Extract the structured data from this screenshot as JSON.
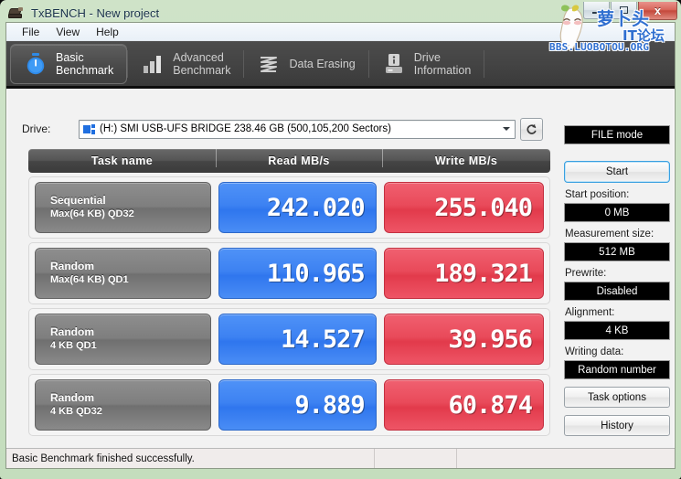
{
  "window": {
    "title": "TxBENCH - New project",
    "icon": "drive-stack-icon",
    "minimize_label": "–",
    "maximize_label": "□",
    "close_label": "x"
  },
  "menu": {
    "items": [
      {
        "label": "File"
      },
      {
        "label": "View"
      },
      {
        "label": "Help"
      }
    ]
  },
  "tabs": [
    {
      "label": "Basic\nBenchmark",
      "icon": "stopwatch-icon",
      "active": true
    },
    {
      "label": "Advanced\nBenchmark",
      "icon": "bar-chart-icon",
      "active": false
    },
    {
      "label": "Data Erasing",
      "icon": "shredder-icon",
      "active": false
    },
    {
      "label": "Drive\nInformation",
      "icon": "drive-info-icon",
      "active": false
    }
  ],
  "drive": {
    "label": "Drive:",
    "selected": "(H:) SMI USB-UFS BRIDGE  238.46 GB (500,105,200 Sectors)",
    "icon": "drive-icon",
    "refresh_icon": "refresh-icon"
  },
  "table": {
    "headers": [
      "Task name",
      "Read MB/s",
      "Write MB/s"
    ],
    "rows": [
      {
        "name_line1": "Sequential",
        "name_line2": "Max(64 KB) QD32",
        "read": "242.020",
        "write": "255.040"
      },
      {
        "name_line1": "Random",
        "name_line2": "Max(64 KB) QD1",
        "read": "110.965",
        "write": "189.321"
      },
      {
        "name_line1": "Random",
        "name_line2": "4 KB QD1",
        "read": "14.527",
        "write": "39.956"
      },
      {
        "name_line1": "Random",
        "name_line2": "4 KB QD32",
        "read": "9.889",
        "write": "60.874"
      }
    ]
  },
  "panel": {
    "mode_value": "FILE mode",
    "start_label": "Start",
    "start_position_label": "Start position:",
    "start_position_value": "0 MB",
    "measurement_size_label": "Measurement size:",
    "measurement_size_value": "512 MB",
    "prewrite_label": "Prewrite:",
    "prewrite_value": "Disabled",
    "alignment_label": "Alignment:",
    "alignment_value": "4 KB",
    "writing_data_label": "Writing data:",
    "writing_data_value": "Random number",
    "task_options_label": "Task options",
    "history_label": "History"
  },
  "statusbar": {
    "message": "Basic Benchmark finished successfully.",
    "pane2": "",
    "pane3": ""
  },
  "watermark": {
    "cn_line1": "萝卜头",
    "cn_line2": "IT论坛",
    "url": "BBS.LUOBOTOU.ORG",
    "mascot": "radish-mascot-icon"
  },
  "colors": {
    "read_blue": "#3d82f2",
    "write_red": "#e94a5a",
    "window_frame_green": "#c4ddbd",
    "tab_dark": "#444444",
    "watermark_blue": "#2f6fd0"
  }
}
